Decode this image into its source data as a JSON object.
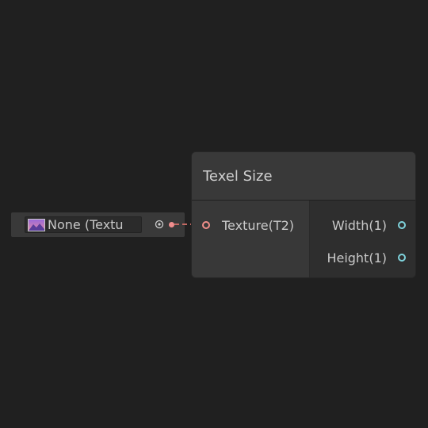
{
  "property_field": {
    "object_label": "None (Textu",
    "thumbnail_icon": "texture-thumbnail-icon",
    "picker_icon": "object-picker-icon",
    "port_color": "#f08e8e"
  },
  "node": {
    "title": "Texel Size",
    "inputs": [
      {
        "label": "Texture(T2)",
        "color": "#f18f8a"
      }
    ],
    "outputs": [
      {
        "label": "Width(1)",
        "color": "#7fd3dc"
      },
      {
        "label": "Height(1)",
        "color": "#7fd3dc"
      }
    ]
  },
  "wire": {
    "color": "#c46a64",
    "style": "dashed"
  }
}
